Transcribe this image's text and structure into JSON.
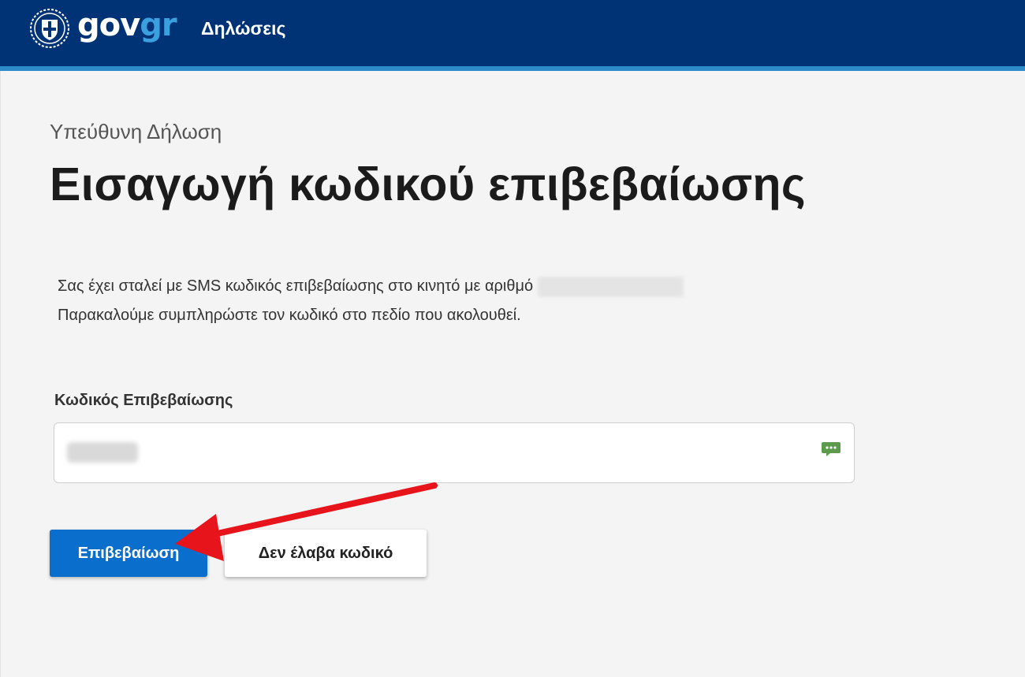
{
  "header": {
    "logo_gov": "gov",
    "logo_gr": "gr",
    "title": "Δηλώσεις",
    "background_color": "#003375",
    "strip_color": "#2e8bc9"
  },
  "main": {
    "caption": "Υπεύθυνη Δήλωση",
    "title": "Εισαγωγή κωδικού επιβεβαίωσης",
    "description_line1": "Σας έχει σταλεί με SMS κωδικός επιβεβαίωσης στο κινητό με αριθμό",
    "description_line2": "Παρακαλούμε συμπληρώστε τον κωδικό στο πεδίο που ακολουθεί.",
    "field_label": "Κωδικός Επιβεβαίωσης",
    "input_icon": "sms-icon",
    "confirm_button": "Επιβεβαίωση",
    "resend_button": "Δεν έλαβα κωδικό",
    "primary_color": "#0a6fcc",
    "annotation_color": "#e8141c"
  }
}
